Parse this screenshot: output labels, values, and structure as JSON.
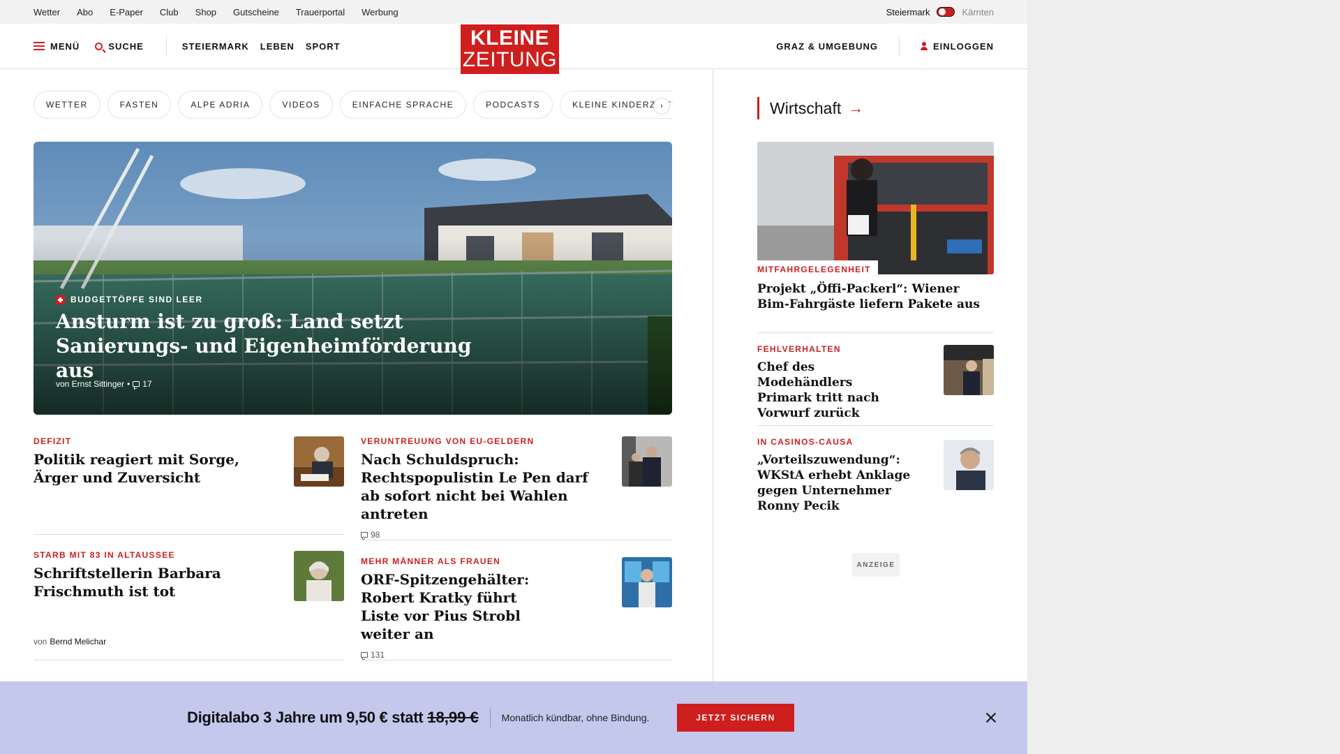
{
  "utility": {
    "links": [
      "Wetter",
      "Abo",
      "E-Paper",
      "Club",
      "Shop",
      "Gutscheine",
      "Trauerportal",
      "Werbung"
    ],
    "region_active": "Steiermark",
    "region_inactive": "Kärnten"
  },
  "header": {
    "menu_label": "MENÜ",
    "search_label": "SUCHE",
    "nav": [
      "STEIERMARK",
      "LEBEN",
      "SPORT"
    ],
    "logo_line1": "KLEINE",
    "logo_line2": "ZEITUNG",
    "local_label": "GRAZ & UMGEBUNG",
    "login_label": "EINLOGGEN",
    "brand_color": "#cf1e1e"
  },
  "chips": [
    "WETTER",
    "FASTEN",
    "ALPE ADRIA",
    "VIDEOS",
    "EINFACHE SPRACHE",
    "PODCASTS",
    "KLEINE KINDERZEITUNG"
  ],
  "hero": {
    "kicker": "BUDGETTÖPFE SIND LEER",
    "title": "Ansturm ist zu groß: Land setzt Sanierungs- und Eigenheimförderung aus",
    "author": "von Ernst Sittinger",
    "separator": "•",
    "comments": "17"
  },
  "articles": [
    {
      "kicker": "DEFIZIT",
      "title": "Politik reagiert mit Sorge, Ärger und Zuversicht"
    },
    {
      "kicker": "VERUNTREUUNG VON EU-GELDERN",
      "title": "Nach Schuldspruch: Rechtspopulistin Le Pen darf ab sofort nicht bei Wahlen antreten",
      "comments": "98"
    },
    {
      "kicker": "STARB MIT 83 IN ALTAUSSEE",
      "title": "Schriftstellerin Barbara Frischmuth ist tot",
      "author_prefix": "von",
      "author": "Bernd Melichar"
    },
    {
      "kicker": "MEHR MÄNNER ALS FRAUEN",
      "title": "ORF-Spitzengehälter: Robert Kratky führt Liste vor Pius Strobl weiter an",
      "comments": "131"
    }
  ],
  "sidebar": {
    "section": "Wirtschaft",
    "arrow": "→",
    "items": [
      {
        "kicker": "MITFAHRGELEGENHEIT",
        "title": "Projekt „Öffi-Packerl“: Wiener Bim-Fahrgäste liefern Pakete aus"
      },
      {
        "kicker": "FEHLVERHALTEN",
        "title": "Chef des Modehändlers Primark tritt nach Vorwurf zurück"
      },
      {
        "kicker": "IN CASINOS-CAUSA",
        "title": "„Vorteilszuwendung“: WKStA erhebt Anklage gegen Unternehmer Ronny Pecik"
      }
    ],
    "ad_label": "ANZEIGE"
  },
  "banner": {
    "offer": "Digitalabo 3 Jahre um 9,50 € statt",
    "old_price": "18,99 €",
    "note": "Monatlich kündbar, ohne Bindung.",
    "cta": "JETZT SICHERN",
    "background": "#c3c8ec"
  }
}
